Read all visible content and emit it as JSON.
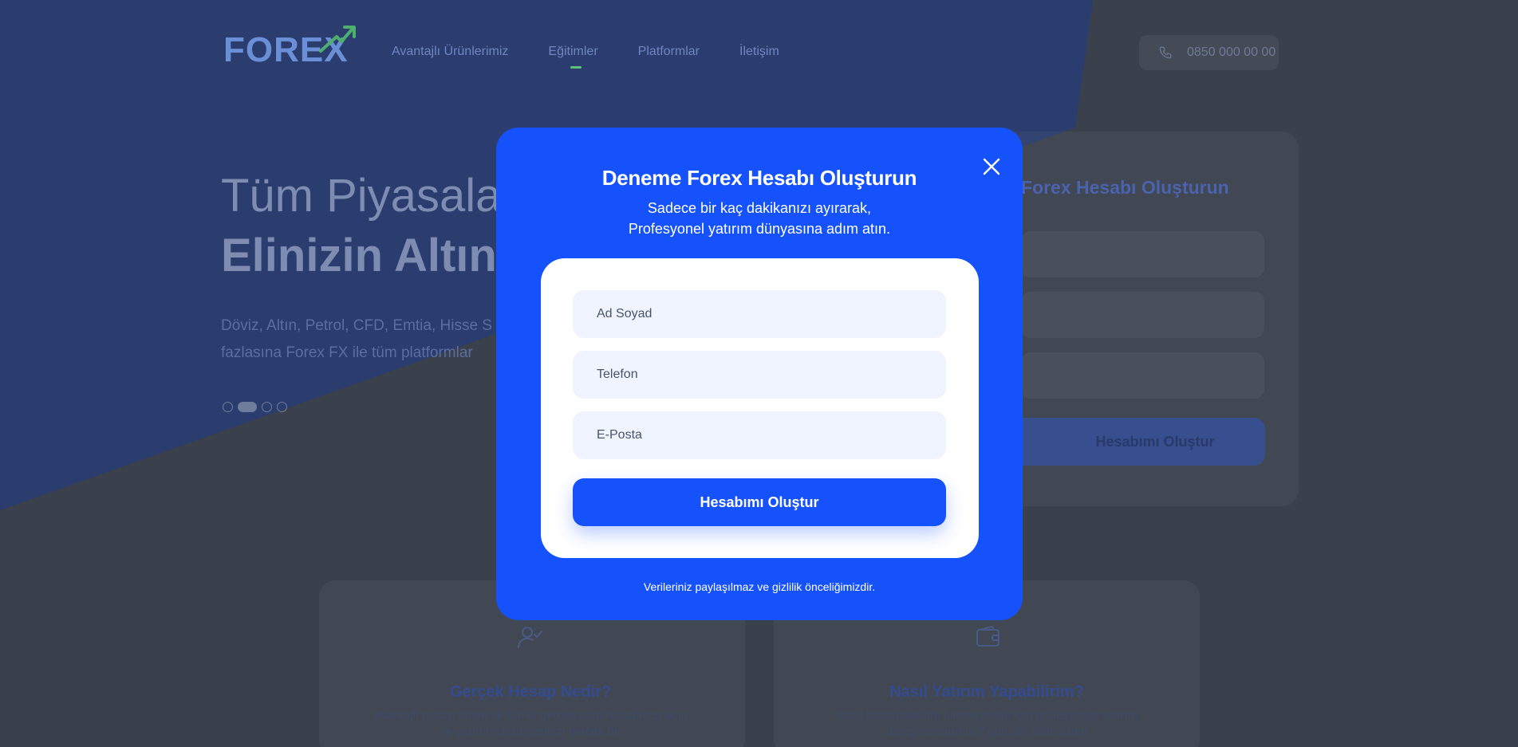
{
  "colors": {
    "modal_bg": "#1652fb",
    "hero_bg": "#2f4376",
    "page_bg": "#3a404c",
    "field_bg": "#eff4ff",
    "accent_green": "#5ac07a"
  },
  "header": {
    "logo": "FOREX",
    "logo_icon": "trend-arrow-icon",
    "nav": [
      "Avantajlı Ürünlerimiz",
      "Eğitimler",
      "Platformlar",
      "İletişim"
    ],
    "active_nav": "Eğitimler",
    "phone": "0850 000 00 00",
    "phone_icon": "phone-icon"
  },
  "hero": {
    "title_line1": "Tüm Piyasalar",
    "title_line2": "Elinizin Altınd",
    "description": "Döviz, Altın, Petrol, CFD, Emtia, Hisse S fazlasına Forex FX ile tüm platformlar",
    "slider_dots": 4,
    "active_dot": 1
  },
  "side_form": {
    "title": "Forex Hesabı Oluşturun",
    "button": "Hesabımı Oluştur"
  },
  "features": [
    {
      "icon": "user-check-icon",
      "title": "Gerçek Hesap Nedir?",
      "text": "Avantajlı hesap türleri ile Şimdi gerçek para hesabınızı açın ve yatırım stratejilerinizi gerçek bir"
    },
    {
      "icon": "wallet-icon",
      "title": "Nasıl Yatırım Yapabilirim?",
      "text": "Nasıl başlayacağını bilemeyenler için profesyonel yatırım danışmanlarımız 7 gün, 24 saat sizleri"
    }
  ],
  "modal": {
    "title": "Deneme Forex Hesabı Oluşturun",
    "subtitle_line1": "Sadece bir kaç dakikanızı ayırarak,",
    "subtitle_line2": "Profesyonel yatırım dünyasına adım atın.",
    "fields": {
      "name_placeholder": "Ad Soyad",
      "phone_placeholder": "Telefon",
      "email_placeholder": "E-Posta"
    },
    "submit": "Hesabımı Oluştur",
    "note": "Verileriniz paylaşılmaz ve gizlilik önceliğimizdir.",
    "close_icon": "close-icon"
  }
}
